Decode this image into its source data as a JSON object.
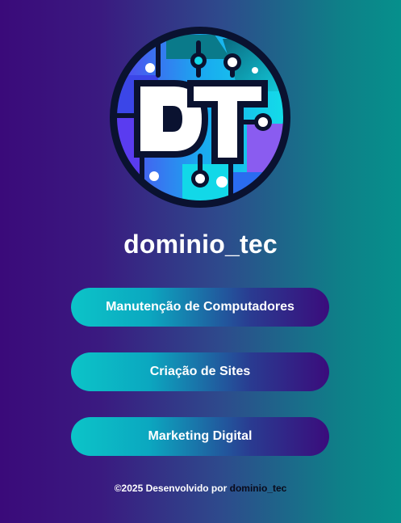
{
  "logo": {
    "icon": "dt-circuit-logo-icon",
    "letters": "DT",
    "colors": {
      "ring": "#0a1230",
      "cyan": "#12d8e8",
      "blue": "#2a6cf0",
      "purple": "#8a5cf0",
      "teal": "#0a7a8a"
    }
  },
  "site": {
    "title": "dominio_tec"
  },
  "links": [
    {
      "label": "Manutenção de Computadores"
    },
    {
      "label": "Criação de Sites"
    },
    {
      "label": "Marketing Digital"
    }
  ],
  "footer": {
    "prefix": "©2025 Desenvolvido por ",
    "brand": "dominio_tec"
  },
  "theme": {
    "bg_left": "#3a0a7a",
    "bg_right": "#06908c",
    "button_left": "#0cc4c8",
    "button_right": "#3a0c7c"
  }
}
